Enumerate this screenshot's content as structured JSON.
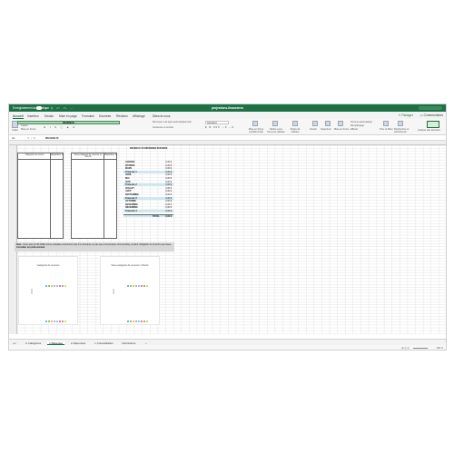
{
  "titlebar": {
    "autosave_label": "Enregistrement automatique",
    "toggle_state": "off",
    "doc_title": "projections-financieres"
  },
  "tabs": [
    "Accueil",
    "Insertion",
    "Dessin",
    "Mise en page",
    "Formules",
    "Données",
    "Révision",
    "Affichage",
    "Dites-le-nous"
  ],
  "active_tab": "Accueil",
  "share_label": "Partager",
  "comments_label": "Commentaires",
  "ribbon": {
    "paste": "Coller",
    "cut": "Couper",
    "copy": "Copier",
    "format": "Mise en forme",
    "font": "Calibri (Corps)",
    "wrap": "Renvoyer à la ligne automatiquement",
    "merge": "Fusionner et centrer",
    "number_format": "Standard",
    "cond_format": "Mise en forme conditionnelle",
    "table_format": "Mettre sous forme de tableau",
    "cell_styles": "Styles de cellules",
    "insert": "Insérer",
    "delete": "Supprimer",
    "cell_format": "Mise en forme",
    "autosum": "Somme automatique",
    "fill": "Remplissage",
    "clear": "Effacer",
    "sort": "Trier et filtrer",
    "find": "Rechercher et sélectionner",
    "analyze": "Analyse des données"
  },
  "formulabar": {
    "cell": "A1",
    "value": "REVENUS"
  },
  "sheet": {
    "revenus_banner": "REVENUS",
    "table1_headers": [
      "Catégorie de revenu",
      "Répartition %"
    ],
    "table2_headers": [
      "Sous-catégorie de revenus ou Clients",
      "Répartition %"
    ],
    "monthly_title": "REVENUS VS DÉPENSES PAR MOIS",
    "months": [
      {
        "label": "JANVIER",
        "value": "0,00 $"
      },
      {
        "label": "FÉVRIER",
        "value": "0,00 $"
      },
      {
        "label": "MARS",
        "value": "0,00 $"
      },
      {
        "label": "Trimestre 1",
        "value": "0,00 $",
        "tri": true
      },
      {
        "label": "AVRIL",
        "value": "0,00 $"
      },
      {
        "label": "MAI",
        "value": "0,00 $"
      },
      {
        "label": "JUIN",
        "value": "0,00 $"
      },
      {
        "label": "Trimestre 2",
        "value": "0,00 $",
        "tri": true
      },
      {
        "label": "JUILLET",
        "value": "0,00 $"
      },
      {
        "label": "AOÛT",
        "value": "0,00 $"
      },
      {
        "label": "SEPTEMBRE",
        "value": "0,00 $"
      },
      {
        "label": "Trimestre 3",
        "value": "0,00 $",
        "tri": true
      },
      {
        "label": "OCTOBRE",
        "value": "0,00 $"
      },
      {
        "label": "NOVEMBRE",
        "value": "0,00 $"
      },
      {
        "label": "DÉCEMBRE",
        "value": "0,00 $"
      },
      {
        "label": "Trimestre 4",
        "value": "0,00 $",
        "tri": true
      }
    ],
    "total_label": "TOTAL",
    "total_value": "0,00 $",
    "note_prefix": "Note :",
    "note_text": "Si les plus de 50 000$ comme travailleur autonome (très d'en fermante ou pas que à d'entreprise commerciale), la dans l'obligation de s'inscrire aux taxes.",
    "note_link": "Consulter un professionnel."
  },
  "charts": [
    {
      "title": "Catégorie de revenus",
      "dot_colors": [
        "#1f77b4",
        "#2ca02c",
        "#ff7f0e",
        "#9467bd",
        "#17becf",
        "#d62728",
        "#8c564b",
        "#bcbd22"
      ]
    },
    {
      "title": "Sous-catégorie de revenus / Clients",
      "dot_colors": [
        "#1f77b4",
        "#2ca02c",
        "#ff7f0e",
        "#9467bd",
        "#17becf",
        "#d62728",
        "#8c564b",
        "#bcbd22"
      ]
    }
  ],
  "sheet_tabs": [
    {
      "label": "Catégories",
      "color": "#2e7d32"
    },
    {
      "label": "Revenus",
      "color": "#8e24aa",
      "active": true
    },
    {
      "label": "Dépenses",
      "color": "#c2185b"
    },
    {
      "label": "Consolidation",
      "color": "#43a047"
    },
    {
      "label": "Instructions",
      "color": ""
    }
  ],
  "status": {
    "zoom": "100 %"
  },
  "colors": {
    "excel_green": "#1e7145"
  }
}
